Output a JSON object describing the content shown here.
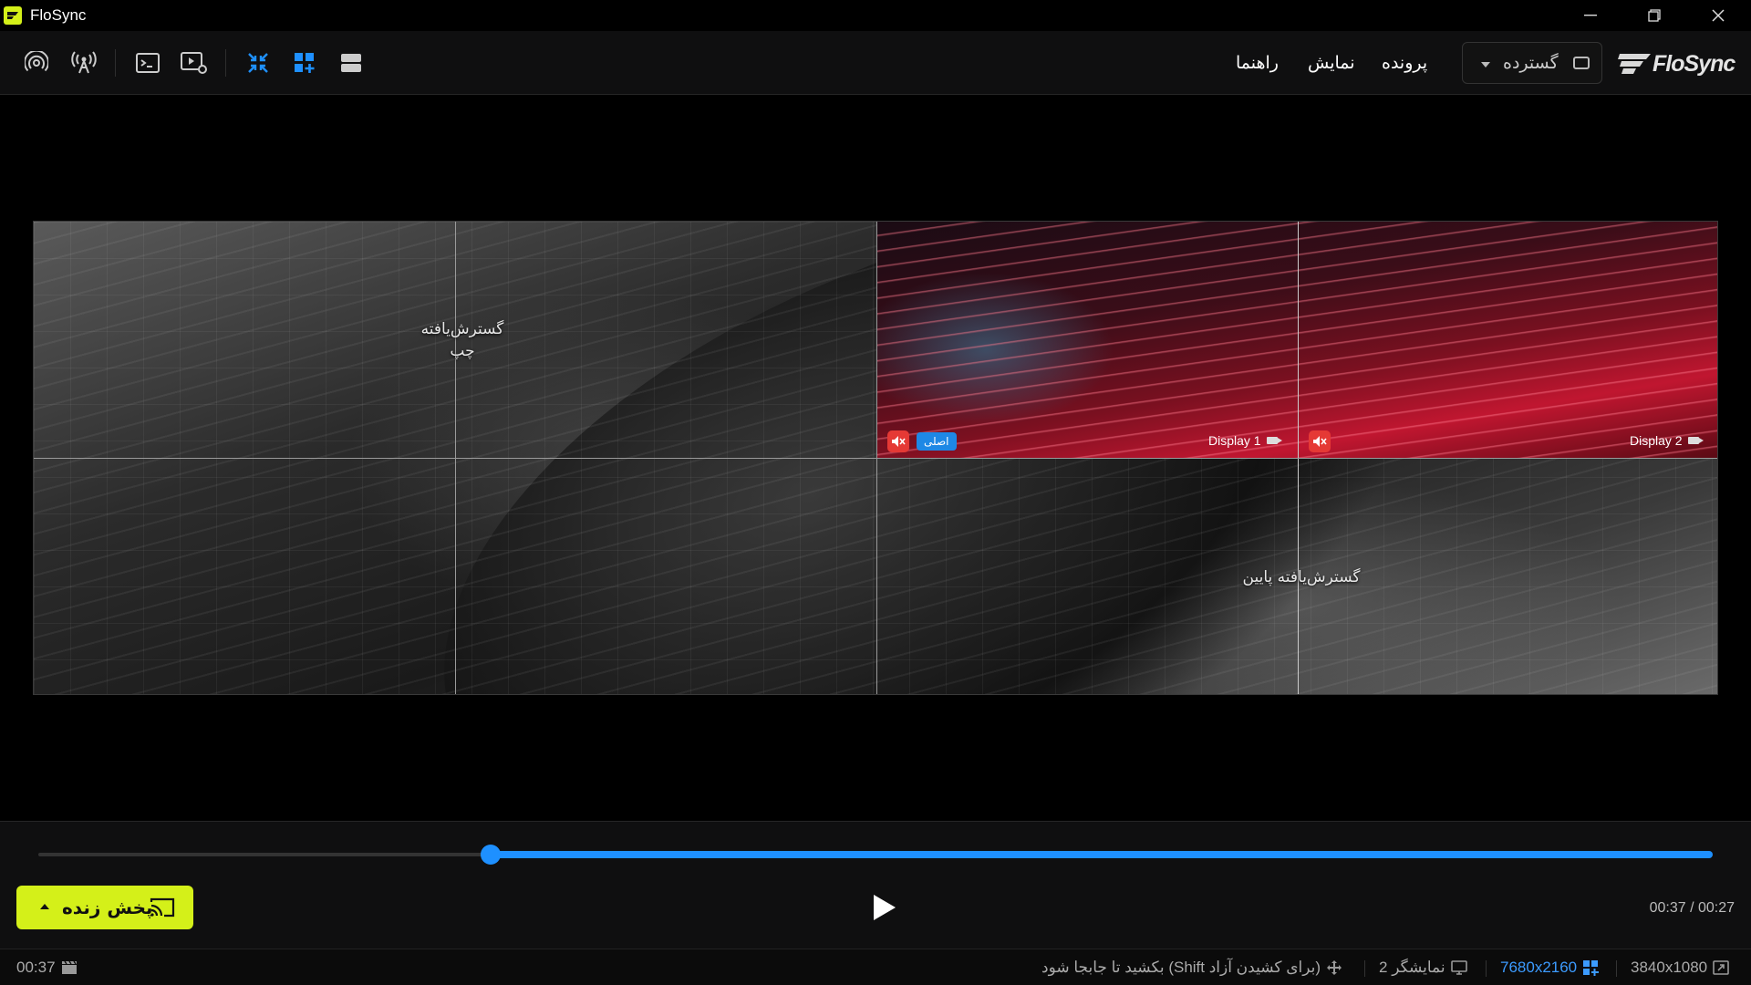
{
  "app": {
    "title": "FloSync",
    "brand": "FloSync"
  },
  "menu": {
    "file": "پرونده",
    "view": "نمایش",
    "help": "راهنما"
  },
  "mode_select": {
    "selected": "گسترده"
  },
  "toolbar_icons": [
    "broadcast-icon",
    "antenna-icon",
    "terminal-icon",
    "video-settings-icon",
    "compress-icon",
    "grid-add-icon",
    "rows-icon"
  ],
  "wall": {
    "zone_left": "گسترش‌یافته\nچپ",
    "zone_bottom": "گسترش‌یافته پایین",
    "display1": "Display 1",
    "display2": "Display 2",
    "primary": "اصلی"
  },
  "player": {
    "progress": 0.27,
    "time": "00:37 / 00:27",
    "live_label": "پخش زنده"
  },
  "status": {
    "duration": "00:37",
    "hint": "بکشید تا جابجا شود (Shift برای کشیدن آزاد)",
    "displays": "2 نمایشگر",
    "canvas_res": "7680x2160",
    "display_res": "3840x1080"
  },
  "colors": {
    "accent": "#d4f019",
    "progress": "#1e90ff",
    "mute": "#e53935",
    "primary_badge": "#1e88e5"
  }
}
